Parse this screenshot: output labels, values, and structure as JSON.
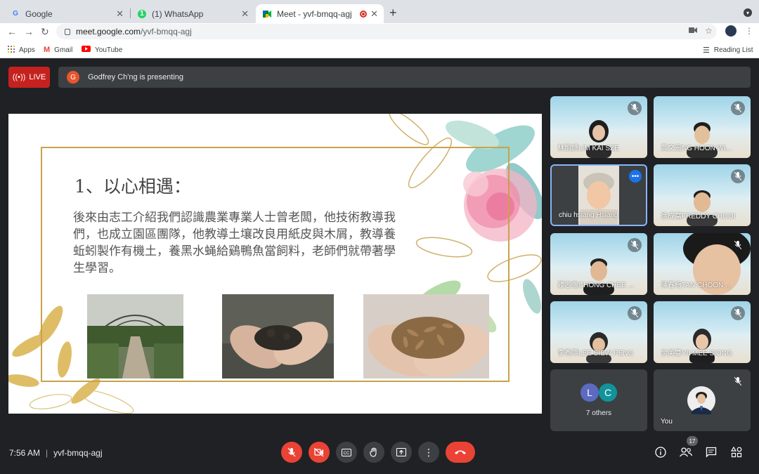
{
  "browser": {
    "tabs": [
      {
        "title": "Google",
        "icon": "google-icon"
      },
      {
        "title": "(1) WhatsApp",
        "icon": "whatsapp-icon"
      },
      {
        "title": "Meet - yvf-bmqq-agj",
        "icon": "meet-icon"
      }
    ],
    "url_host": "meet.google.com",
    "url_path": "/yvf-bmqq-agj",
    "bookmarks": [
      "Apps",
      "Gmail",
      "YouTube"
    ],
    "reading_list": "Reading List"
  },
  "meet": {
    "live_label": "LIVE",
    "presenter_initial": "G",
    "presenting_text": "Godfrey Ch'ng is presenting",
    "slide": {
      "title": "1、以心相遇：",
      "body": "後來由志工介紹我們認識農業專業人士曾老闆，他技術教導我們，也成立園區團隊，他教導土壤改良用紙皮與木屑，教導養蚯蚓製作有機土，養黑水蝇給鷄鴨魚當飼料，老師們就帶著學生學習。"
    },
    "participants": [
      {
        "name": "林凱詩LIM KAI SZE",
        "muted": true
      },
      {
        "name": "黃文宏NG HOON WI...",
        "muted": true
      },
      {
        "name": "chiu hsiang Hsiang",
        "muted": false,
        "active": true
      },
      {
        "name": "徐成富FREDDY CHOOI",
        "muted": true
      },
      {
        "name": "鍾志強CHONG CHEE ...",
        "muted": true
      },
      {
        "name": "陳春梅TAN CHOON ...",
        "muted": true
      },
      {
        "name": "李秀萍LEE SIEW PENG",
        "muted": true
      },
      {
        "name": "余美雙YII MEE SIONG",
        "muted": true
      }
    ],
    "others": {
      "avatars": [
        "L",
        "C"
      ],
      "label": "7 others"
    },
    "you_label": "You",
    "time": "7:56 AM",
    "meeting_code": "yvf-bmqq-agj",
    "people_count": "17"
  },
  "colors": {
    "live": "#c5221f",
    "end_call": "#ea4335",
    "accent": "#1a73e8"
  }
}
